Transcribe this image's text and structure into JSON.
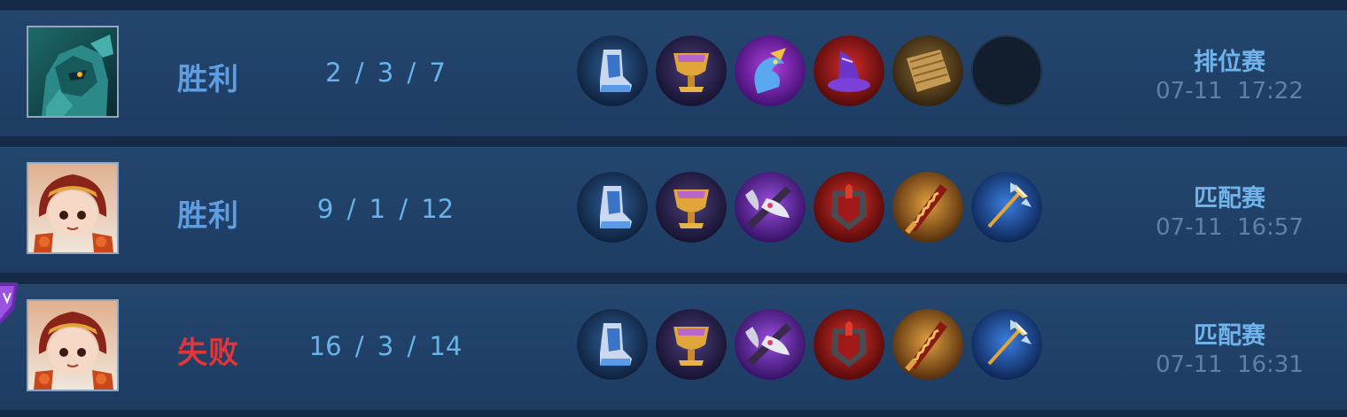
{
  "matches": [
    {
      "hero_icon": "green-armored-mech-hero-portrait",
      "result": "胜利",
      "result_type": "win",
      "kda": "2 / 3 / 7",
      "items": [
        "blue-boots-icon",
        "gold-chalice-icon",
        "purple-dragon-staff-icon",
        "red-wizard-hat-icon",
        "wooden-shield-plate-icon",
        "empty-slot"
      ],
      "mode": "排位赛",
      "time": "07-11  17:22"
    },
    {
      "hero_icon": "red-haired-girl-hero-portrait",
      "result": "胜利",
      "result_type": "win",
      "kda": "9 / 1 / 12",
      "items": [
        "blue-boots-icon",
        "gold-chalice-icon",
        "purple-battle-axe-icon",
        "red-armor-helm-icon",
        "golden-serrated-blade-icon",
        "blue-trident-icon"
      ],
      "mode": "匹配赛",
      "time": "07-11  16:57"
    },
    {
      "hero_icon": "red-haired-girl-hero-portrait",
      "result": "失败",
      "result_type": "loss",
      "kda": "16 / 3 / 14",
      "items": [
        "blue-boots-icon",
        "gold-chalice-icon",
        "purple-battle-axe-icon",
        "red-armor-helm-icon",
        "golden-serrated-blade-icon",
        "blue-trident-icon"
      ],
      "mode": "匹配赛",
      "time": "07-11  16:31"
    }
  ],
  "colors": {
    "win": "#5d9de0",
    "loss": "#e0353a",
    "kda": "#66b4ea",
    "mode": "#6fb3ea",
    "time": "#5f80a7",
    "row_bg": "#22436a",
    "page_bg": "#152a46"
  }
}
